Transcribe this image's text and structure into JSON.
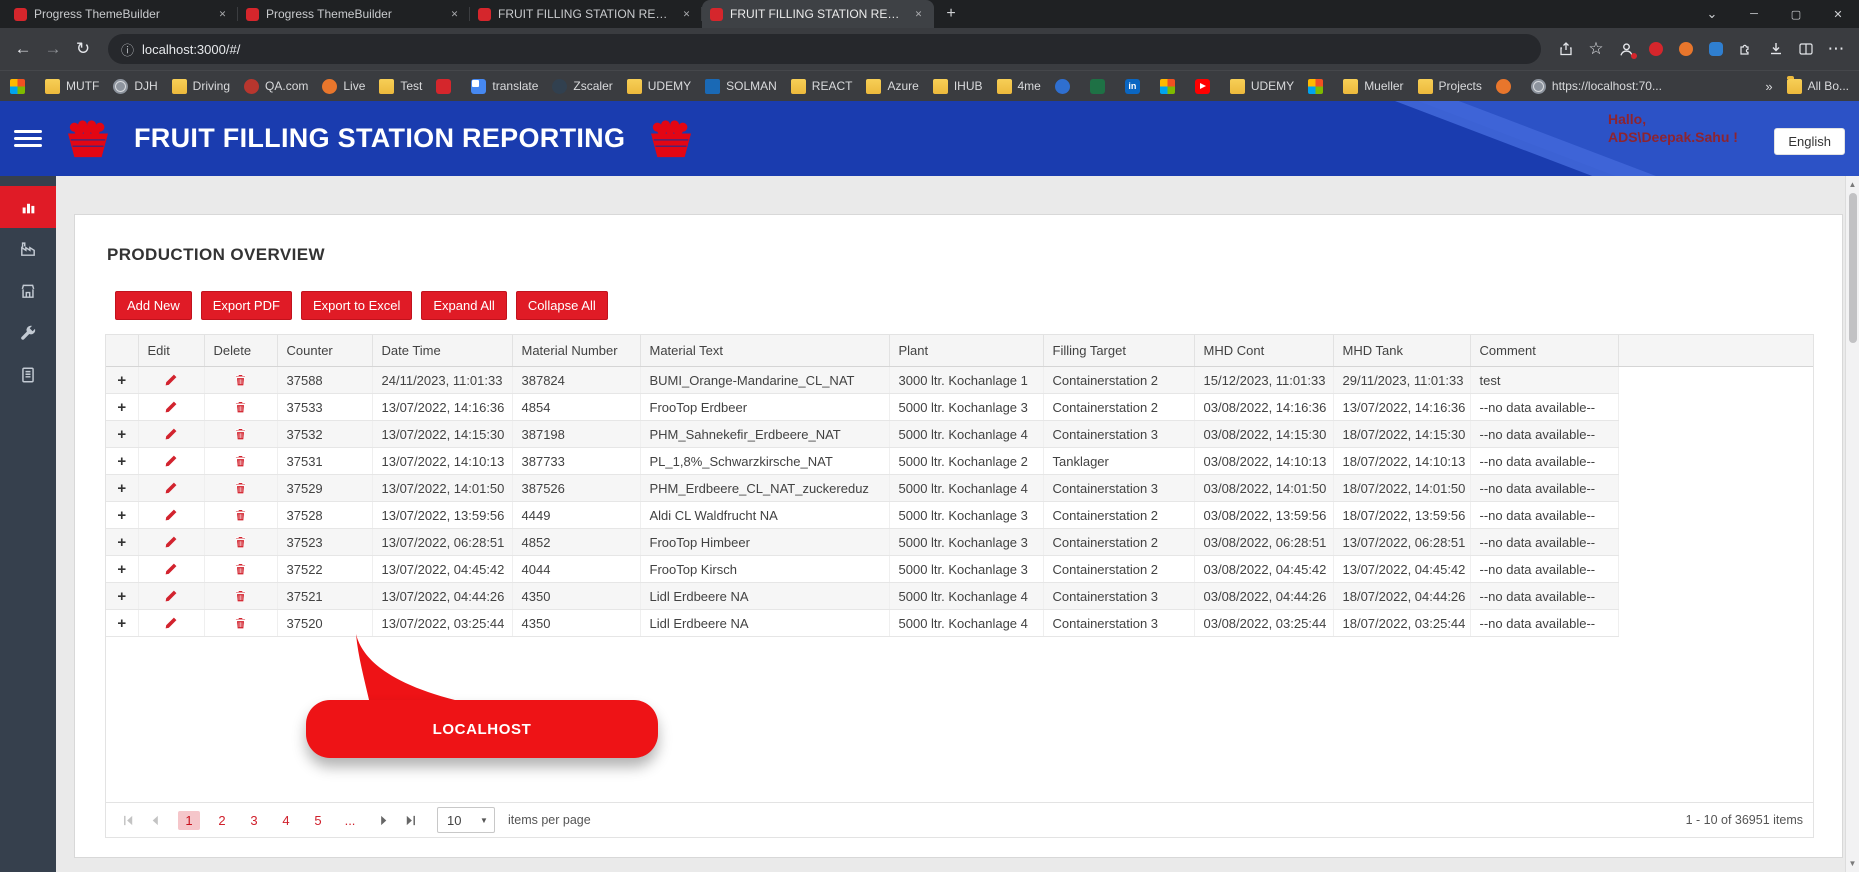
{
  "glyphs": {
    "close": "✕",
    "new_tab": "+",
    "tab_actions": "⌄",
    "minimize": "─",
    "maximize": "▢",
    "back": "←",
    "forward": "→",
    "reload": "↻",
    "site_info": "ⓘ",
    "star": "☆",
    "menu": "⋯",
    "overflow": "»",
    "caret_down": "▼",
    "expand_row": "+",
    "scroll_up": "▲",
    "scroll_down": "▼"
  },
  "browser": {
    "tabs": [
      {
        "title": "Progress ThemeBuilder",
        "icon": "progress-red"
      },
      {
        "title": "Progress ThemeBuilder",
        "icon": "progress-red"
      },
      {
        "title": "FRUIT FILLING STATION REPORT",
        "icon": "app-red"
      },
      {
        "title": "FRUIT FILLING STATION REPORT",
        "icon": "app-red",
        "active": true
      }
    ],
    "url": "localhost:3000/#/",
    "bookmarks": [
      {
        "icon": "msgrid",
        "label": ""
      },
      {
        "icon": "folder",
        "label": "MUTF"
      },
      {
        "icon": "globe",
        "label": "DJH"
      },
      {
        "icon": "folder",
        "label": "Driving"
      },
      {
        "icon": "ffx",
        "label": "QA.com"
      },
      {
        "icon": "orange",
        "label": "Live"
      },
      {
        "icon": "folder",
        "label": "Test"
      },
      {
        "icon": "redsq",
        "label": ""
      },
      {
        "icon": "translate",
        "label": "translate"
      },
      {
        "icon": "dark",
        "label": "Zscaler"
      },
      {
        "icon": "folder",
        "label": "UDEMY"
      },
      {
        "icon": "sap",
        "label": "SOLMAN"
      },
      {
        "icon": "folder",
        "label": "REACT"
      },
      {
        "icon": "folder",
        "label": "Azure"
      },
      {
        "icon": "folder",
        "label": "IHUB"
      },
      {
        "icon": "folder",
        "label": "4me"
      },
      {
        "icon": "blue",
        "label": ""
      },
      {
        "icon": "excel",
        "label": ""
      },
      {
        "icon": "linkedin",
        "label": ""
      },
      {
        "icon": "msgrid",
        "label": ""
      },
      {
        "icon": "youtube",
        "label": ""
      },
      {
        "icon": "folder",
        "label": "UDEMY"
      },
      {
        "icon": "msgrid",
        "label": ""
      },
      {
        "icon": "folder",
        "label": "Mueller"
      },
      {
        "icon": "folder",
        "label": "Projects"
      },
      {
        "icon": "orange",
        "label": ""
      },
      {
        "icon": "globe",
        "label": "https://localhost:70..."
      }
    ],
    "all_bookmarks_label": "All Bo..."
  },
  "app": {
    "colors": {
      "accent_red": "#e01b26",
      "header_blue": "#1a3caf",
      "sidebar_dark": "#36404d"
    },
    "header": {
      "title": "FRUIT FILLING STATION REPORTING",
      "greeting_line1": "Hallo,",
      "greeting_line2": "ADS\\Deepak.Sahu !",
      "language_button": "English"
    },
    "sidebar": {
      "items": [
        "bar-chart",
        "factory",
        "store",
        "wrench",
        "report"
      ]
    },
    "page_title": "PRODUCTION OVERVIEW",
    "toolbar": [
      "Add New",
      "Export PDF",
      "Export to Excel",
      "Expand All",
      "Collapse All"
    ],
    "table": {
      "columns": [
        "",
        "Edit",
        "Delete",
        "Counter",
        "Date Time",
        "Material Number",
        "Material Text",
        "Plant",
        "Filling Target",
        "MHD Cont",
        "MHD Tank",
        "Comment",
        ""
      ],
      "rows": [
        {
          "counter": "37588",
          "date_time": "24/11/2023, 11:01:33",
          "material_number": "387824",
          "material_text": "BUMI_Orange-Mandarine_CL_NAT",
          "plant": "3000 ltr. Kochanlage 1",
          "filling_target": "Containerstation 2",
          "mhd_cont": "15/12/2023, 11:01:33",
          "mhd_tank": "29/11/2023, 11:01:33",
          "comment": "test"
        },
        {
          "counter": "37533",
          "date_time": "13/07/2022, 14:16:36",
          "material_number": "4854",
          "material_text": "FrooTop Erdbeer",
          "plant": "5000 ltr. Kochanlage 3",
          "filling_target": "Containerstation 2",
          "mhd_cont": "03/08/2022, 14:16:36",
          "mhd_tank": "13/07/2022, 14:16:36",
          "comment": "--no data available--"
        },
        {
          "counter": "37532",
          "date_time": "13/07/2022, 14:15:30",
          "material_number": "387198",
          "material_text": "PHM_Sahnekefir_Erdbeere_NAT",
          "plant": "5000 ltr. Kochanlage 4",
          "filling_target": "Containerstation 3",
          "mhd_cont": "03/08/2022, 14:15:30",
          "mhd_tank": "18/07/2022, 14:15:30",
          "comment": "--no data available--"
        },
        {
          "counter": "37531",
          "date_time": "13/07/2022, 14:10:13",
          "material_number": "387733",
          "material_text": "PL_1,8%_Schwarzkirsche_NAT",
          "plant": "5000 ltr. Kochanlage 2",
          "filling_target": "Tanklager",
          "mhd_cont": "03/08/2022, 14:10:13",
          "mhd_tank": "18/07/2022, 14:10:13",
          "comment": "--no data available--"
        },
        {
          "counter": "37529",
          "date_time": "13/07/2022, 14:01:50",
          "material_number": "387526",
          "material_text": "PHM_Erdbeere_CL_NAT_zuckereduz",
          "plant": "5000 ltr. Kochanlage 4",
          "filling_target": "Containerstation 3",
          "mhd_cont": "03/08/2022, 14:01:50",
          "mhd_tank": "18/07/2022, 14:01:50",
          "comment": "--no data available--"
        },
        {
          "counter": "37528",
          "date_time": "13/07/2022, 13:59:56",
          "material_number": "4449",
          "material_text": "Aldi CL Waldfrucht NA",
          "plant": "5000 ltr. Kochanlage 3",
          "filling_target": "Containerstation 2",
          "mhd_cont": "03/08/2022, 13:59:56",
          "mhd_tank": "18/07/2022, 13:59:56",
          "comment": "--no data available--"
        },
        {
          "counter": "37523",
          "date_time": "13/07/2022, 06:28:51",
          "material_number": "4852",
          "material_text": "FrooTop Himbeer",
          "plant": "5000 ltr. Kochanlage 3",
          "filling_target": "Containerstation 2",
          "mhd_cont": "03/08/2022, 06:28:51",
          "mhd_tank": "13/07/2022, 06:28:51",
          "comment": "--no data available--"
        },
        {
          "counter": "37522",
          "date_time": "13/07/2022, 04:45:42",
          "material_number": "4044",
          "material_text": "FrooTop Kirsch",
          "plant": "5000 ltr. Kochanlage 3",
          "filling_target": "Containerstation 2",
          "mhd_cont": "03/08/2022, 04:45:42",
          "mhd_tank": "13/07/2022, 04:45:42",
          "comment": "--no data available--"
        },
        {
          "counter": "37521",
          "date_time": "13/07/2022, 04:44:26",
          "material_number": "4350",
          "material_text": "Lidl Erdbeere NA",
          "plant": "5000 ltr. Kochanlage 4",
          "filling_target": "Containerstation 3",
          "mhd_cont": "03/08/2022, 04:44:26",
          "mhd_tank": "18/07/2022, 04:44:26",
          "comment": "--no data available--"
        },
        {
          "counter": "37520",
          "date_time": "13/07/2022, 03:25:44",
          "material_number": "4350",
          "material_text": "Lidl Erdbeere NA",
          "plant": "5000 ltr. Kochanlage 4",
          "filling_target": "Containerstation 3",
          "mhd_cont": "03/08/2022, 03:25:44",
          "mhd_tank": "18/07/2022, 03:25:44",
          "comment": "--no data available--"
        }
      ]
    },
    "callout": {
      "text": "LOCALHOST"
    },
    "pager": {
      "pages": [
        {
          "label": "1",
          "active": true
        },
        {
          "label": "2"
        },
        {
          "label": "3"
        },
        {
          "label": "4"
        },
        {
          "label": "5"
        },
        {
          "label": "..."
        }
      ],
      "page_size": "10",
      "items_per_page_label": "items per page",
      "range_label": "1 - 10 of 36951 items"
    }
  }
}
